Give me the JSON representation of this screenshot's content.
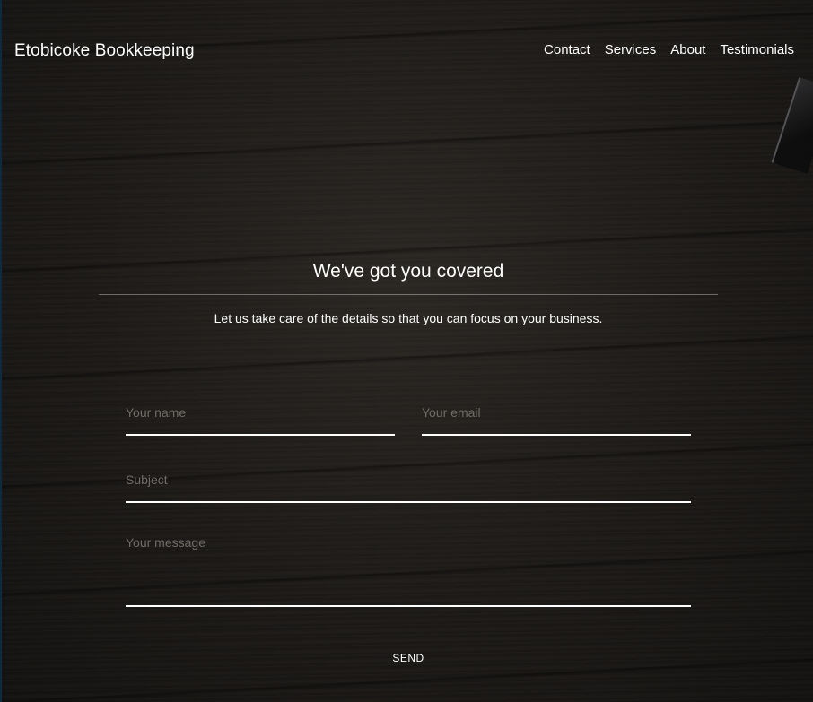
{
  "header": {
    "brand": "Etobicoke Bookkeeping",
    "nav": [
      {
        "label": "Contact"
      },
      {
        "label": "Services"
      },
      {
        "label": "About"
      },
      {
        "label": "Testimonials"
      }
    ]
  },
  "hero": {
    "title": "We've got you covered",
    "subtitle": "Let us take care of the details so that you can focus on your business."
  },
  "form": {
    "name_placeholder": "Your name",
    "email_placeholder": "Your email",
    "subject_placeholder": "Subject",
    "message_placeholder": "Your message",
    "send_label": "SEND"
  },
  "colors": {
    "text": "#ffffff",
    "placeholder": "#6f6b66",
    "background": "#1b1a19"
  }
}
